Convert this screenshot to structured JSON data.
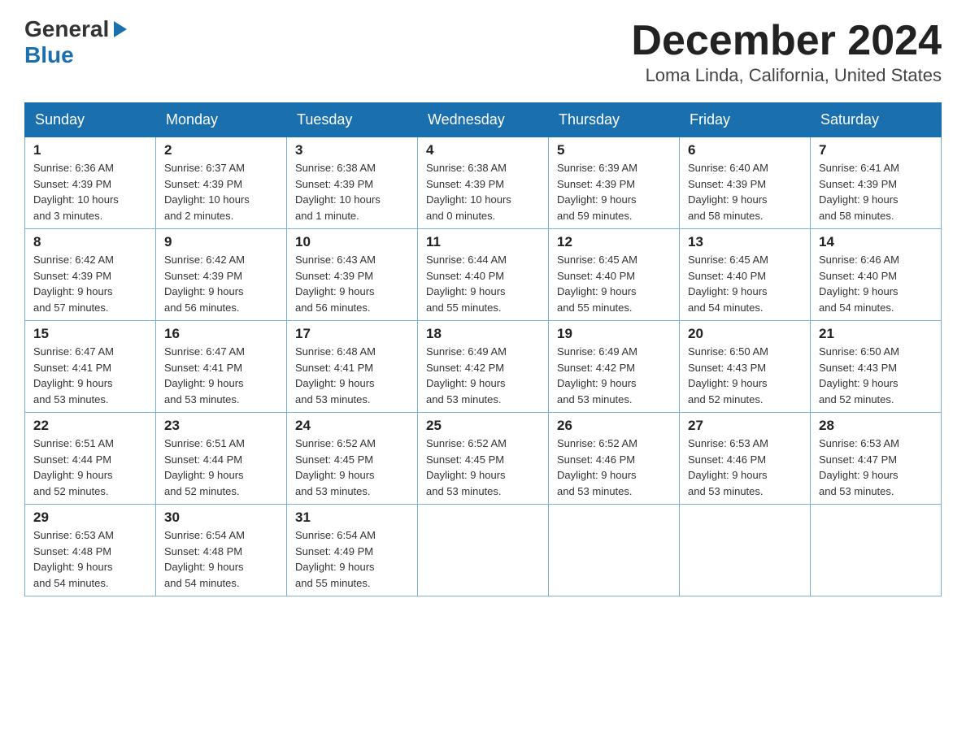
{
  "header": {
    "logo_general": "General",
    "logo_blue": "Blue",
    "month_title": "December 2024",
    "location": "Loma Linda, California, United States"
  },
  "weekdays": [
    "Sunday",
    "Monday",
    "Tuesday",
    "Wednesday",
    "Thursday",
    "Friday",
    "Saturday"
  ],
  "weeks": [
    [
      {
        "day": "1",
        "info": "Sunrise: 6:36 AM\nSunset: 4:39 PM\nDaylight: 10 hours\nand 3 minutes."
      },
      {
        "day": "2",
        "info": "Sunrise: 6:37 AM\nSunset: 4:39 PM\nDaylight: 10 hours\nand 2 minutes."
      },
      {
        "day": "3",
        "info": "Sunrise: 6:38 AM\nSunset: 4:39 PM\nDaylight: 10 hours\nand 1 minute."
      },
      {
        "day": "4",
        "info": "Sunrise: 6:38 AM\nSunset: 4:39 PM\nDaylight: 10 hours\nand 0 minutes."
      },
      {
        "day": "5",
        "info": "Sunrise: 6:39 AM\nSunset: 4:39 PM\nDaylight: 9 hours\nand 59 minutes."
      },
      {
        "day": "6",
        "info": "Sunrise: 6:40 AM\nSunset: 4:39 PM\nDaylight: 9 hours\nand 58 minutes."
      },
      {
        "day": "7",
        "info": "Sunrise: 6:41 AM\nSunset: 4:39 PM\nDaylight: 9 hours\nand 58 minutes."
      }
    ],
    [
      {
        "day": "8",
        "info": "Sunrise: 6:42 AM\nSunset: 4:39 PM\nDaylight: 9 hours\nand 57 minutes."
      },
      {
        "day": "9",
        "info": "Sunrise: 6:42 AM\nSunset: 4:39 PM\nDaylight: 9 hours\nand 56 minutes."
      },
      {
        "day": "10",
        "info": "Sunrise: 6:43 AM\nSunset: 4:39 PM\nDaylight: 9 hours\nand 56 minutes."
      },
      {
        "day": "11",
        "info": "Sunrise: 6:44 AM\nSunset: 4:40 PM\nDaylight: 9 hours\nand 55 minutes."
      },
      {
        "day": "12",
        "info": "Sunrise: 6:45 AM\nSunset: 4:40 PM\nDaylight: 9 hours\nand 55 minutes."
      },
      {
        "day": "13",
        "info": "Sunrise: 6:45 AM\nSunset: 4:40 PM\nDaylight: 9 hours\nand 54 minutes."
      },
      {
        "day": "14",
        "info": "Sunrise: 6:46 AM\nSunset: 4:40 PM\nDaylight: 9 hours\nand 54 minutes."
      }
    ],
    [
      {
        "day": "15",
        "info": "Sunrise: 6:47 AM\nSunset: 4:41 PM\nDaylight: 9 hours\nand 53 minutes."
      },
      {
        "day": "16",
        "info": "Sunrise: 6:47 AM\nSunset: 4:41 PM\nDaylight: 9 hours\nand 53 minutes."
      },
      {
        "day": "17",
        "info": "Sunrise: 6:48 AM\nSunset: 4:41 PM\nDaylight: 9 hours\nand 53 minutes."
      },
      {
        "day": "18",
        "info": "Sunrise: 6:49 AM\nSunset: 4:42 PM\nDaylight: 9 hours\nand 53 minutes."
      },
      {
        "day": "19",
        "info": "Sunrise: 6:49 AM\nSunset: 4:42 PM\nDaylight: 9 hours\nand 53 minutes."
      },
      {
        "day": "20",
        "info": "Sunrise: 6:50 AM\nSunset: 4:43 PM\nDaylight: 9 hours\nand 52 minutes."
      },
      {
        "day": "21",
        "info": "Sunrise: 6:50 AM\nSunset: 4:43 PM\nDaylight: 9 hours\nand 52 minutes."
      }
    ],
    [
      {
        "day": "22",
        "info": "Sunrise: 6:51 AM\nSunset: 4:44 PM\nDaylight: 9 hours\nand 52 minutes."
      },
      {
        "day": "23",
        "info": "Sunrise: 6:51 AM\nSunset: 4:44 PM\nDaylight: 9 hours\nand 52 minutes."
      },
      {
        "day": "24",
        "info": "Sunrise: 6:52 AM\nSunset: 4:45 PM\nDaylight: 9 hours\nand 53 minutes."
      },
      {
        "day": "25",
        "info": "Sunrise: 6:52 AM\nSunset: 4:45 PM\nDaylight: 9 hours\nand 53 minutes."
      },
      {
        "day": "26",
        "info": "Sunrise: 6:52 AM\nSunset: 4:46 PM\nDaylight: 9 hours\nand 53 minutes."
      },
      {
        "day": "27",
        "info": "Sunrise: 6:53 AM\nSunset: 4:46 PM\nDaylight: 9 hours\nand 53 minutes."
      },
      {
        "day": "28",
        "info": "Sunrise: 6:53 AM\nSunset: 4:47 PM\nDaylight: 9 hours\nand 53 minutes."
      }
    ],
    [
      {
        "day": "29",
        "info": "Sunrise: 6:53 AM\nSunset: 4:48 PM\nDaylight: 9 hours\nand 54 minutes."
      },
      {
        "day": "30",
        "info": "Sunrise: 6:54 AM\nSunset: 4:48 PM\nDaylight: 9 hours\nand 54 minutes."
      },
      {
        "day": "31",
        "info": "Sunrise: 6:54 AM\nSunset: 4:49 PM\nDaylight: 9 hours\nand 55 minutes."
      },
      {
        "day": "",
        "info": ""
      },
      {
        "day": "",
        "info": ""
      },
      {
        "day": "",
        "info": ""
      },
      {
        "day": "",
        "info": ""
      }
    ]
  ]
}
